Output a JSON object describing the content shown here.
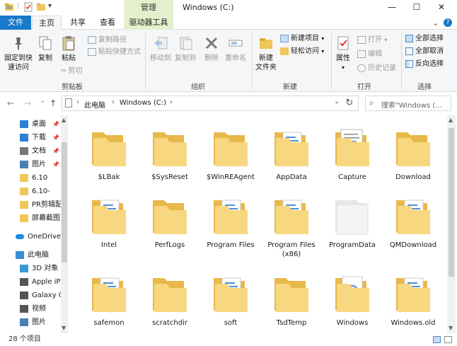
{
  "title_bar": {
    "window_title": "Windows (C:)",
    "manage_tab": "管理",
    "minimize": "—",
    "maximize": "☐",
    "close": "✕"
  },
  "tabs": {
    "file": "文件",
    "home": "主页",
    "share": "共享",
    "view": "查看",
    "drive_tools": "驱动器工具"
  },
  "ribbon": {
    "clipboard": {
      "pin_quick_access": "固定到快\n速访问",
      "copy": "复制",
      "paste": "粘贴",
      "copy_path": "复制路径",
      "paste_shortcut": "粘贴快捷方式",
      "cut": "剪切",
      "group_label": "剪贴板"
    },
    "organize": {
      "move_to": "移动到",
      "copy_to": "复制到",
      "delete": "删除",
      "rename": "重命名",
      "group_label": "组织"
    },
    "new": {
      "new_folder": "新建\n文件夹",
      "new_item": "新建项目",
      "easy_access": "轻松访问",
      "group_label": "新建"
    },
    "open": {
      "properties": "属性",
      "open": "打开",
      "edit": "编辑",
      "history": "历史记录",
      "group_label": "打开"
    },
    "select": {
      "select_all": "全部选择",
      "select_none": "全部取消",
      "invert": "反向选择",
      "group_label": "选择"
    }
  },
  "address": {
    "back": "←",
    "forward": "→",
    "dropdown": "⌄",
    "up": "↑",
    "path": [
      "此电脑",
      "Windows (C:)"
    ],
    "separator": "›",
    "refresh": "↻",
    "search_placeholder": "搜索\"Windows (..."
  },
  "sidebar": {
    "items": [
      {
        "label": "桌面",
        "icon": "desktop-icon",
        "pinned": true,
        "color": "#2d7fd3"
      },
      {
        "label": "下载",
        "icon": "download-icon",
        "pinned": true,
        "color": "#2d7fd3"
      },
      {
        "label": "文档",
        "icon": "document-icon",
        "pinned": true,
        "color": "#777777"
      },
      {
        "label": "图片",
        "icon": "pictures-icon",
        "pinned": true,
        "color": "#4a7fb5"
      },
      {
        "label": "6.10",
        "icon": "folder-icon",
        "pinned": false,
        "color": "#f0c85a"
      },
      {
        "label": "6.10-",
        "icon": "folder-icon",
        "pinned": false,
        "color": "#f0c85a"
      },
      {
        "label": "PR剪辑配",
        "icon": "folder-icon",
        "pinned": false,
        "color": "#f0c85a"
      },
      {
        "label": "屏幕截图",
        "icon": "folder-icon",
        "pinned": false,
        "color": "#f0c85a"
      },
      {
        "label": "OneDrive",
        "icon": "onedrive-icon",
        "pinned": false,
        "color": "#1e88e5"
      },
      {
        "label": "此电脑",
        "icon": "pc-icon",
        "pinned": false,
        "color": "#3a8bd6"
      },
      {
        "label": "3D 对象",
        "icon": "3d-objects-icon",
        "pinned": false,
        "color": "#3a9ad9"
      },
      {
        "label": "Apple iPl",
        "icon": "iphone-icon",
        "pinned": false,
        "color": "#555555"
      },
      {
        "label": "Galaxy O",
        "icon": "phone-icon",
        "pinned": false,
        "color": "#555555"
      },
      {
        "label": "视频",
        "icon": "video-icon",
        "pinned": false,
        "color": "#555555"
      },
      {
        "label": "图片",
        "icon": "pictures-icon",
        "pinned": false,
        "color": "#4a7fb5"
      }
    ]
  },
  "folders": [
    {
      "name": "$LBak",
      "kind": "empty"
    },
    {
      "name": "$SysReset",
      "kind": "empty"
    },
    {
      "name": "$WinREAgent",
      "kind": "empty"
    },
    {
      "name": "AppData",
      "kind": "files"
    },
    {
      "name": "Capture",
      "kind": "docs"
    },
    {
      "name": "Download",
      "kind": "empty"
    },
    {
      "name": "Intel",
      "kind": "files"
    },
    {
      "name": "PerfLogs",
      "kind": "empty"
    },
    {
      "name": "Program Files",
      "kind": "files"
    },
    {
      "name": "Program Files\n(x86)",
      "kind": "files"
    },
    {
      "name": "ProgramData",
      "kind": "white"
    },
    {
      "name": "QMDownload",
      "kind": "files"
    },
    {
      "name": "safemon",
      "kind": "files"
    },
    {
      "name": "scratchdir",
      "kind": "empty"
    },
    {
      "name": "soft",
      "kind": "files"
    },
    {
      "name": "TsdTemp",
      "kind": "empty"
    },
    {
      "name": "Windows",
      "kind": "gear"
    },
    {
      "name": "Windows.old",
      "kind": "files"
    }
  ],
  "status": {
    "count": "28 个项目"
  },
  "colors": {
    "file_tab": "#1979ca",
    "manage_tab": "#e3f0cd",
    "folder_back": "#e8b84a",
    "folder_front": "#f7d780",
    "ribbon_bg": "#f5f6f7"
  }
}
